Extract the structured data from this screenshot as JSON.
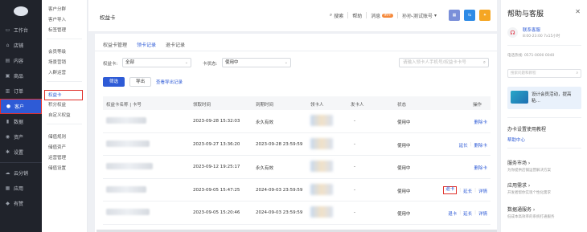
{
  "nav": {
    "items": [
      {
        "label": "工作台",
        "icon": "monitor-icon"
      },
      {
        "label": "店铺",
        "icon": "store-icon"
      },
      {
        "label": "内容",
        "icon": "content-icon"
      },
      {
        "label": "商品",
        "icon": "goods-icon"
      },
      {
        "label": "订单",
        "icon": "order-icon"
      },
      {
        "label": "客户",
        "icon": "user-icon",
        "active": true
      },
      {
        "label": "数据",
        "icon": "chart-icon"
      },
      {
        "label": "资产",
        "icon": "asset-icon"
      },
      {
        "label": "设置",
        "icon": "gear-icon"
      }
    ],
    "extra": [
      {
        "label": "云分销",
        "icon": "cloud-icon"
      },
      {
        "label": "应用",
        "icon": "apps-icon"
      },
      {
        "label": "有赞",
        "icon": "bag-icon"
      }
    ]
  },
  "subnav": {
    "group1": [
      "客户分群",
      "客户导入",
      "标签管理"
    ],
    "group2": [
      "会员等级",
      "场景营销",
      "入群运营"
    ],
    "group3": [
      {
        "label": "权益卡",
        "active": true
      },
      {
        "label": "积分权益"
      },
      {
        "label": "自定义权益"
      }
    ],
    "group4": [
      "储值规则",
      "储值资产",
      "运营管理",
      "储值设置"
    ]
  },
  "topbar": {
    "title": "权益卡",
    "search": "搜索",
    "help": "帮助",
    "messages": "消息",
    "messages_badge": "99+",
    "account": "孙孙-测试账号"
  },
  "tabs": [
    "权益卡管理",
    "领卡记录",
    "退卡记录"
  ],
  "filters": {
    "card_label": "权益卡:",
    "card_value": "全部",
    "status_label": "卡状态:",
    "status_value": "使用中",
    "search_placeholder": "请输入领卡人手机号/权益卡卡号"
  },
  "actions": {
    "filter": "筛选",
    "export": "导出",
    "view_export": "查看导出记录"
  },
  "table": {
    "headers": [
      "权益卡名称 | 卡号",
      "领取时间",
      "到期时间",
      "领卡人",
      "发卡人",
      "状态",
      "操作"
    ],
    "rows": [
      {
        "received": "2023-09-28 15:32:03",
        "expire": "永久有效",
        "issuer": "-",
        "status": "使用中",
        "ops": [
          "删除卡"
        ],
        "hl": -1
      },
      {
        "received": "2023-09-27 13:36:20",
        "expire": "2023-09-28 23:59:59",
        "issuer": "-",
        "status": "使用中",
        "ops": [
          "延长",
          "删除卡"
        ],
        "hl": -1
      },
      {
        "received": "2023-09-12 19:25:17",
        "expire": "永久有效",
        "issuer": "-",
        "status": "使用中",
        "ops": [
          "删除卡"
        ],
        "hl": -1
      },
      {
        "received": "2023-09-05 15:47:25",
        "expire": "2024-09-03 23:59:59",
        "issuer": "-",
        "status": "使用中",
        "ops": [
          "退卡",
          "延长",
          "详情"
        ],
        "hl": 0
      },
      {
        "received": "2023-09-05 15:20:46",
        "expire": "2024-09-03 23:59:59",
        "issuer": "-",
        "status": "使用中",
        "ops": [
          "退卡",
          "延长",
          "详情"
        ],
        "hl": -1
      }
    ]
  },
  "help": {
    "title": "帮助与客服",
    "service": "联系客服",
    "hours": "8:00-23:00  7x15小时",
    "phone": "电话热线: 0571-0000 0040",
    "search_placeholder": "搜索问题和教程",
    "banner": "设计会员活动，提高粘…",
    "section1": "办卡设置使用教程",
    "center": "帮助中心",
    "s2_title": "服务市场 ›",
    "s2_desc": "为你提供店铺运营解决方案",
    "s3_title": "应用需求 ›",
    "s3_desc": "开发者帮你实现个性化需求",
    "s4_title": "数据通服务 ›",
    "s4_desc": "低成本高效率的系统打通服务"
  }
}
